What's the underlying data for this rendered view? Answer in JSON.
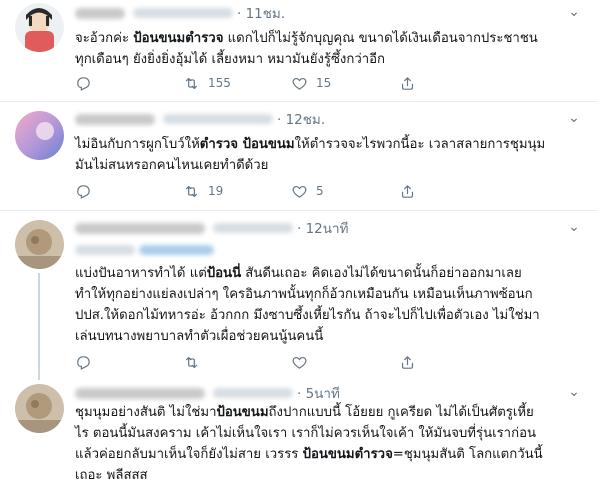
{
  "tweets": [
    {
      "time": "· 11ชม.",
      "lines": [
        [
          {
            "t": "จะอ้วกค่ะ "
          },
          {
            "t": "ป้อนขนมตำรวจ",
            "b": true
          },
          {
            "t": " แดกไปก็ไม่รู้จักบุญคุณ ขนาดได้เงินเดือนจากประชาชน"
          }
        ],
        [
          {
            "t": "ทุกเดือนๆ ยังยิ่งยิ่งอุ้มได้ เลี้ยงหมา หมามันยังรู้ซึ้งกว่าอีก"
          }
        ]
      ],
      "retweets": "155",
      "likes": "15"
    },
    {
      "time": "· 12ชม.",
      "lines": [
        [
          {
            "t": "ไม่อินกับการผูกโบว์ให้"
          },
          {
            "t": "ตำรวจ ป้อนขนม",
            "b": true
          },
          {
            "t": "ให้ตำรวจจะไรพวกนี้อะ เวลาสลายการชุมนุม"
          }
        ],
        [
          {
            "t": "มันไม่สนหรอกคนไหนเคยทำดีด้วย"
          }
        ]
      ],
      "retweets": "19",
      "likes": "5"
    },
    {
      "time": "· 12นาที",
      "lines": [
        [
          {
            "t": "แบ่งปันอาหารทำได้ แต่"
          },
          {
            "t": "ป้อนนี่",
            "b": true
          },
          {
            "t": " สันดีนเถอะ คิดเองไม่ได้ขนาดนั้นก็อย่าออกมาเลย"
          }
        ],
        [
          {
            "t": "ทำให้ทุกอย่างแย่ลงเปล่าๆ ใครอินภาพนั้นทุกก็อ้วกเหมือนกัน เหมือนเห็นภาพซ้อนก"
          }
        ],
        [
          {
            "t": "ปปส.ให้ดอกไม้ทหารอ่ะ อ้วกกก มึงซาบซึ้งเหี้ยไรกัน ถ้าจะไปก็ไปเพื่อตัวเอง ไม่ใช่มา"
          }
        ],
        [
          {
            "t": "เล่นบทนางพยาบาลทำตัวเผื่อช่วยคนนู้นคนนี้"
          }
        ]
      ],
      "retweets": "",
      "likes": ""
    },
    {
      "time": "· 5นาที",
      "lines": [
        [
          {
            "t": "ชุมนุมอย่างสันติ ไม่ใช่มา"
          },
          {
            "t": "ป้อนขนม",
            "b": true
          },
          {
            "t": "ถึงปากแบบนี้ โอ้ยยย กูเครียด ไม่ได้เป็นศัตรูเหี้ย"
          }
        ],
        [
          {
            "t": "ไร ตอนนี้มันสงคราม เค้าไม่เห็นใจเรา เราก็ไม่ควรเห็นใจเค้า ให้มันจบที่รุ่นเราก่อน"
          }
        ],
        [
          {
            "t": "แล้วค่อยกลับมาเห็นใจก็ยังไม่สาย เวรรร "
          },
          {
            "t": "ป้อนขนมตำรวจ",
            "b": true
          },
          {
            "t": "=ชุมนุมสันติ โลกแตกวันนี้"
          }
        ],
        [
          {
            "t": "เถอะ พลีสสส"
          }
        ]
      ],
      "retweets": "",
      "likes": ""
    }
  ],
  "icons": {
    "reply": "reply-icon",
    "retweet": "retweet-icon",
    "like": "heart-icon",
    "share": "share-icon",
    "more": "more-icon"
  },
  "colors": {
    "text": "#14171a",
    "muted": "#657786",
    "divider": "#e6ecf0",
    "thread": "#ccd6dd"
  }
}
